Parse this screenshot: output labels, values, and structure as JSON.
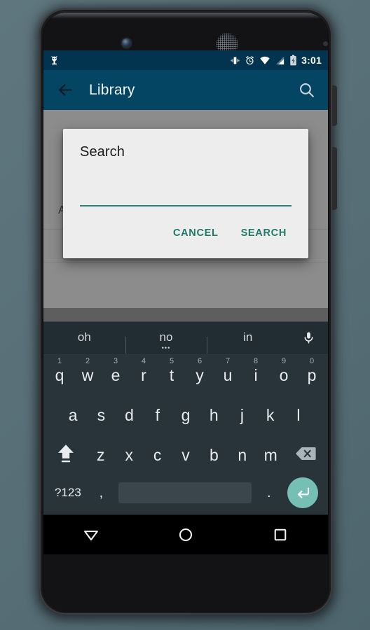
{
  "device": {
    "camera_icon": "front-camera",
    "speaker_icon": "earpiece-speaker",
    "sensor_icon": "proximity-sensor"
  },
  "status_bar": {
    "notification_icon": "android-bug-icon",
    "icons": [
      "vibrate-icon",
      "alarm-icon",
      "wifi-icon",
      "cell-signal-icon",
      "battery-charging-icon"
    ],
    "time": "3:01",
    "background": "#023450"
  },
  "toolbar": {
    "back_icon": "arrow-back-icon",
    "title": "Library",
    "search_icon": "search-icon",
    "background": "#034563"
  },
  "content": {
    "rows": [
      {
        "label": "All About Me"
      },
      {
        "label": ""
      }
    ]
  },
  "dialog": {
    "title": "Search",
    "input_value": "",
    "input_placeholder": "",
    "cancel_label": "CANCEL",
    "search_label": "SEARCH",
    "accent": "#1f7a6b",
    "background": "#ededed"
  },
  "keyboard": {
    "suggestions": [
      {
        "text": "oh",
        "has_dots": false
      },
      {
        "text": "no",
        "has_dots": true
      },
      {
        "text": "in",
        "has_dots": false
      }
    ],
    "dots_glyph": "•••",
    "mic_icon": "microphone-icon",
    "row1": [
      {
        "letter": "q",
        "num": "1"
      },
      {
        "letter": "w",
        "num": "2"
      },
      {
        "letter": "e",
        "num": "3"
      },
      {
        "letter": "r",
        "num": "4"
      },
      {
        "letter": "t",
        "num": "5"
      },
      {
        "letter": "y",
        "num": "6"
      },
      {
        "letter": "u",
        "num": "7"
      },
      {
        "letter": "i",
        "num": "8"
      },
      {
        "letter": "o",
        "num": "9"
      },
      {
        "letter": "p",
        "num": "0"
      }
    ],
    "row2": [
      {
        "letter": "a"
      },
      {
        "letter": "s"
      },
      {
        "letter": "d"
      },
      {
        "letter": "f"
      },
      {
        "letter": "g"
      },
      {
        "letter": "h"
      },
      {
        "letter": "j"
      },
      {
        "letter": "k"
      },
      {
        "letter": "l"
      }
    ],
    "row3": [
      {
        "letter": "z"
      },
      {
        "letter": "x"
      },
      {
        "letter": "c"
      },
      {
        "letter": "v"
      },
      {
        "letter": "b"
      },
      {
        "letter": "n"
      },
      {
        "letter": "m"
      }
    ],
    "shift_icon": "shift-caps-icon",
    "backspace_icon": "backspace-icon",
    "symbols_label": "?123",
    "comma_label": ",",
    "period_label": ".",
    "space_label": "",
    "enter_icon": "enter-return-icon",
    "enter_color": "#76bfb4",
    "background": "#28333a"
  },
  "nav_bar": {
    "back_icon": "keyboard-dismiss-triangle-icon",
    "home_icon": "home-circle-icon",
    "recents_icon": "recents-square-icon"
  }
}
